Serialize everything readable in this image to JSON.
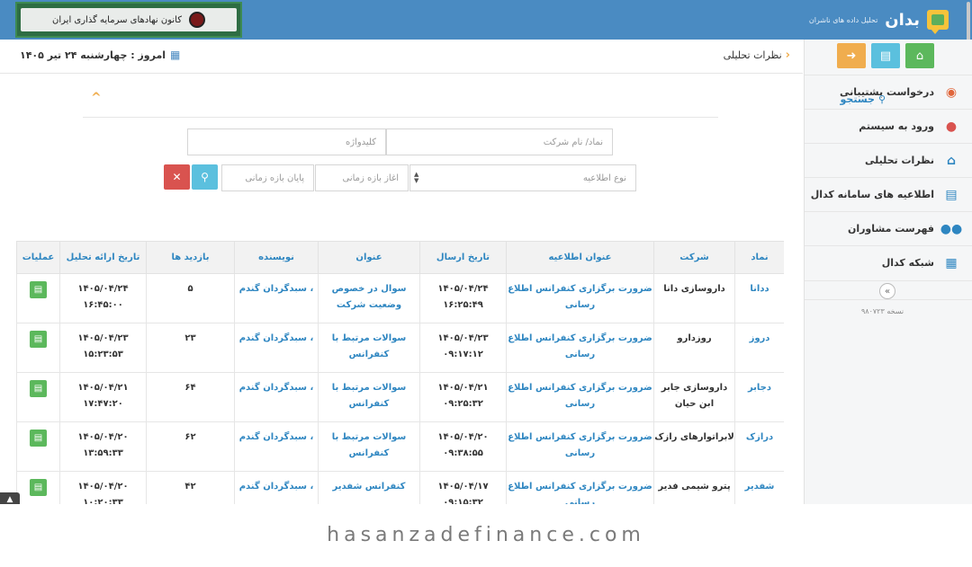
{
  "header": {
    "banner_text": "کانون نهادهای سرمایه گذاری ایران",
    "brand_name": "بدان",
    "brand_sub": "تحلیل داده های ناشران"
  },
  "breadcrumb": {
    "label": "نظرات تحلیلی"
  },
  "today": {
    "label": "امروز : چهارشنبه ۲۴ تیر ۱۴۰۵"
  },
  "sidebar": {
    "items": [
      {
        "label": "درخواست پشتیبانی",
        "icon": "lifebuoy-icon",
        "color": "#e0653a"
      },
      {
        "label": "ورود به سیستم",
        "icon": "user-icon",
        "color": "#d9534f"
      },
      {
        "label": "نظرات تحلیلی",
        "icon": "home-icon",
        "color": "#2e86c1"
      },
      {
        "label": "اطلاعیه های سامانه کدال",
        "icon": "document-icon",
        "color": "#2e86c1"
      },
      {
        "label": "فهرست مشاوران",
        "icon": "users-icon",
        "color": "#2e86c1"
      },
      {
        "label": "شبکه کدال",
        "icon": "grid-icon",
        "color": "#2e86c1"
      }
    ],
    "version": "نسخه ۹۸۰۷۲۳"
  },
  "search": {
    "title": "جستجو",
    "symbol_placeholder": "نماد/ نام شرکت",
    "keyword_placeholder": "کلیدواژه",
    "type_placeholder": "نوع اطلاعیه",
    "start_placeholder": "آغاز بازه زمانی",
    "end_placeholder": "پایان بازه زمانی"
  },
  "table": {
    "columns": [
      "نماد",
      "شرکت",
      "عنوان اطلاعیه",
      "تاریخ ارسال",
      "عنوان",
      "نویسنده",
      "بازدید ها",
      "تاریخ ارائه تحلیل",
      "عملیات"
    ],
    "rows": [
      {
        "symbol": "ددانا",
        "company": "داروسازی دانا",
        "notice": "ضرورت برگزاری کنفرانس اطلاع رسانی",
        "sent": "۱۴۰۵/۰۴/۲۴ ۱۶:۲۵:۴۹",
        "title": "سوال در خصوص وضعیت شرکت",
        "author": "، سبدگردان گندم",
        "views": "۵",
        "analysis_date": "۱۴۰۵/۰۴/۲۴ ۱۶:۴۵:۰۰"
      },
      {
        "symbol": "دروز",
        "company": "روزدارو",
        "notice": "ضرورت برگزاری کنفرانس اطلاع رسانی",
        "sent": "۱۴۰۵/۰۴/۲۳ ۰۹:۱۷:۱۲",
        "title": "سوالات مرتبط با کنفرانس",
        "author": "، سبدگردان گندم",
        "views": "۲۳",
        "analysis_date": "۱۴۰۵/۰۴/۲۳ ۱۵:۲۳:۵۳"
      },
      {
        "symbol": "دجابر",
        "company": "داروسازی جابر ابن حیان",
        "notice": "ضرورت برگزاری کنفرانس اطلاع رسانی",
        "sent": "۱۴۰۵/۰۴/۲۱ ۰۹:۲۵:۳۲",
        "title": "سوالات مرتبط با کنفرانس",
        "author": "، سبدگردان گندم",
        "views": "۶۴",
        "analysis_date": "۱۴۰۵/۰۴/۲۱ ۱۷:۴۷:۲۰"
      },
      {
        "symbol": "درازک",
        "company": "لابراتوارهای رازک",
        "notice": "ضرورت برگزاری کنفرانس اطلاع رسانی",
        "sent": "۱۴۰۵/۰۴/۲۰ ۰۹:۳۸:۵۵",
        "title": "سوالات مرتبط با کنفرانس",
        "author": "، سبدگردان گندم",
        "views": "۶۲",
        "analysis_date": "۱۴۰۵/۰۴/۲۰ ۱۳:۵۹:۳۳"
      },
      {
        "symbol": "شفدیر",
        "company": "پترو شیمی فدیر",
        "notice": "ضرورت برگزاری کنفرانس اطلاع رسانی",
        "sent": "۱۴۰۵/۰۴/۱۷ ۰۹:۱۵:۳۲",
        "title": "کنفرانس شفدیر",
        "author": "، سبدگردان گندم",
        "views": "۴۲",
        "analysis_date": "۱۴۰۵/۰۴/۲۰ ۱۰:۲۰:۳۳"
      }
    ]
  },
  "footer": {
    "watermark": "hasanzadefinance.com"
  }
}
